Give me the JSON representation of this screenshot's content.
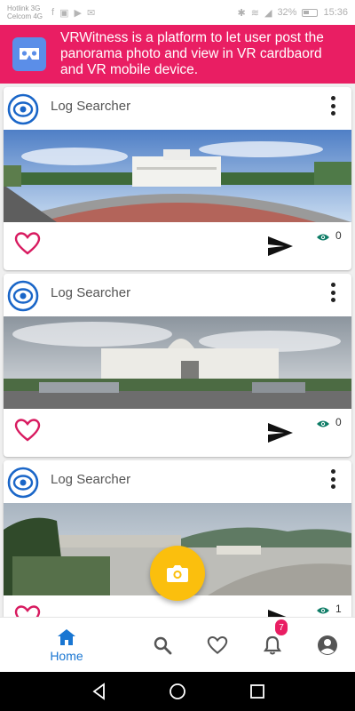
{
  "status_bar": {
    "carrier_line1": "Hotlink 3G",
    "carrier_line2": "Celcom 4G",
    "battery": "32%",
    "time": "15:36"
  },
  "banner": {
    "icon": "vr-cardboard-icon",
    "text": "VRWitness is a platform to let user post the panorama photo and view in VR cardbaord and VR mobile device."
  },
  "feed": {
    "posts": [
      {
        "user": "Log Searcher",
        "views": "0",
        "liked": false
      },
      {
        "user": "Log Searcher",
        "views": "0",
        "liked": false
      },
      {
        "user": "Log Searcher",
        "views": "1",
        "liked": false
      }
    ]
  },
  "fab": {
    "icon": "camera-icon"
  },
  "bottom_nav": {
    "items": [
      {
        "label": "Home",
        "icon": "home-icon",
        "active": true
      },
      {
        "label": "",
        "icon": "search-icon",
        "active": false
      },
      {
        "label": "",
        "icon": "heart-icon",
        "active": false
      },
      {
        "label": "",
        "icon": "bell-icon",
        "active": false
      },
      {
        "label": "",
        "icon": "account-icon",
        "active": false
      }
    ],
    "notification_count": "7"
  },
  "colors": {
    "banner": "#e91e63",
    "accent_blue": "#1976d2",
    "fab": "#fbbf0d",
    "eye": "#0e7c66"
  }
}
